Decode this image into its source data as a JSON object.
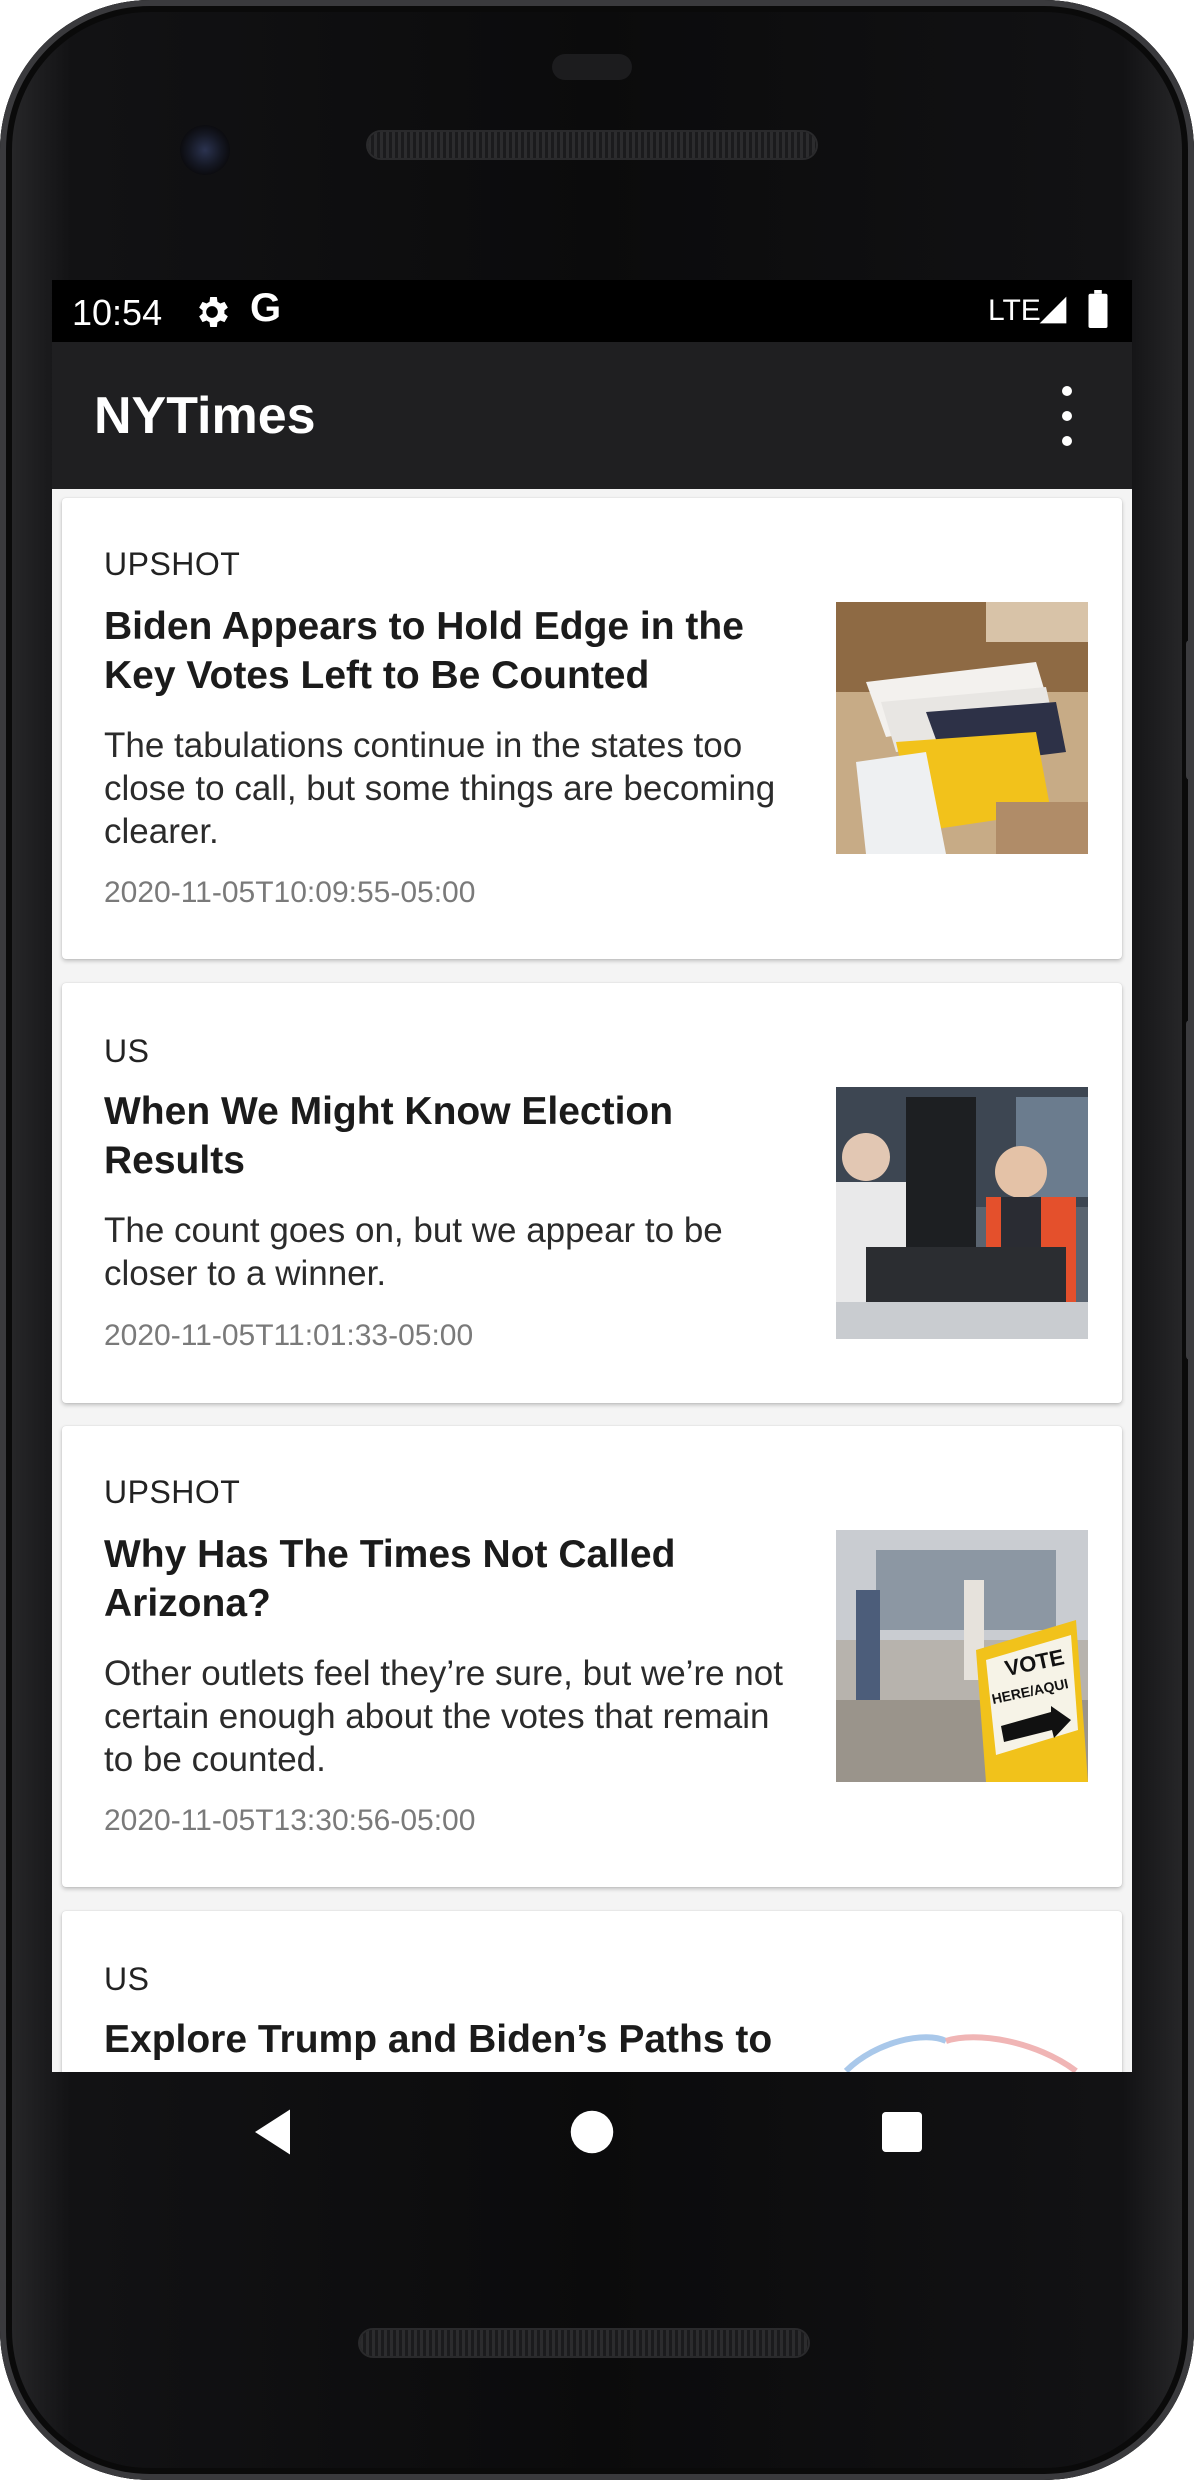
{
  "status_bar": {
    "time": "10:54",
    "network": "LTE",
    "icons": [
      "gear-icon",
      "google-icon",
      "signal-icon",
      "battery-icon"
    ]
  },
  "app_bar": {
    "title": "NYTimes",
    "menu_icon": "overflow-menu-icon"
  },
  "articles": [
    {
      "section": "UPSHOT",
      "headline": "Biden Appears to Hold Edge in the Key Votes Left to Be Counted",
      "abstract": "The tabulations continue in the states too close to call, but some things are becoming clearer.",
      "date": "2020-11-05T10:09:55-05:00",
      "thumbnail": "ballot-envelopes-image"
    },
    {
      "section": "US",
      "headline": "When We Might Know Election Results",
      "abstract": "The count goes on, but we appear to be closer to a winner.",
      "date": "2020-11-05T11:01:33-05:00",
      "thumbnail": "election-workers-image"
    },
    {
      "section": "UPSHOT",
      "headline": "Why Has The Times Not Called Arizona?",
      "abstract": "Other outlets feel they’re sure, but we’re not certain enough about the votes that remain to be counted.",
      "date": "2020-11-05T13:30:56-05:00",
      "thumbnail": "vote-sign-image",
      "thumbnail_text": "VOTE HERE/AQUI"
    },
    {
      "section": "US",
      "headline": "Explore Trump and Biden’s Paths to",
      "thumbnail": "paths-chart-image"
    }
  ],
  "nav_bar": {
    "buttons": [
      "back-icon",
      "home-icon",
      "recents-icon"
    ]
  }
}
